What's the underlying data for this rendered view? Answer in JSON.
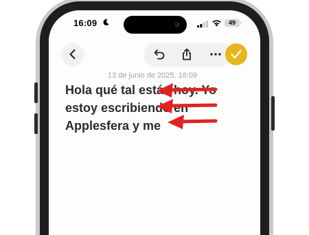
{
  "status_bar": {
    "time": "16:09",
    "battery": "49",
    "icons": [
      "moon-icon",
      "cellular-signal-icon",
      "wifi-icon",
      "battery-icon"
    ]
  },
  "toolbar": {
    "back": "chevron-left-icon",
    "undo": "undo-icon",
    "share": "share-icon",
    "more": "ellipsis-icon",
    "done": "checkmark-icon"
  },
  "note": {
    "date": "13 de junio de 2025, 16:09",
    "body": "Hola qué tal estás hoy. Yo estoy escribiendo en Applesfera y me"
  },
  "colors": {
    "accent": "#e6b620",
    "annotation_arrow": "#e02424",
    "text": "#2b2b2b",
    "date_text": "#a3a3a8"
  },
  "annotations": {
    "count": 3,
    "direction": "left"
  }
}
